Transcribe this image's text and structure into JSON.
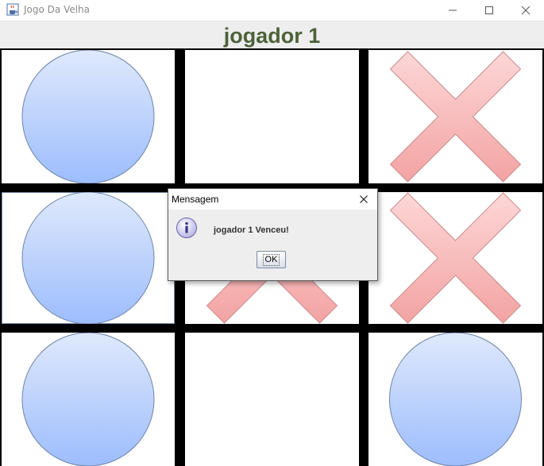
{
  "window": {
    "title": "Jogo Da Velha",
    "icons": {
      "app": "java-cup-icon",
      "minimize": "minimize-icon",
      "maximize": "maximize-icon",
      "close": "close-icon"
    }
  },
  "header": {
    "label": "jogador 1"
  },
  "board": {
    "cells": [
      {
        "mark": "O"
      },
      {
        "mark": ""
      },
      {
        "mark": "X"
      },
      {
        "mark": "O"
      },
      {
        "mark": "X"
      },
      {
        "mark": "X"
      },
      {
        "mark": "O"
      },
      {
        "mark": ""
      },
      {
        "mark": "O"
      }
    ],
    "colors": {
      "o_light": "#dfe9fc",
      "o_dark": "#9dbdfd",
      "o_stroke": "#6f84a8",
      "x_light": "#fdd7d7",
      "x_dark": "#f3a3a3",
      "x_stroke": "#c98d8d",
      "grid": "#000000"
    }
  },
  "dialog": {
    "title": "Mensagem",
    "message": "jogador 1 Venceu!",
    "ok_label": "OK",
    "icon": "info-icon"
  }
}
